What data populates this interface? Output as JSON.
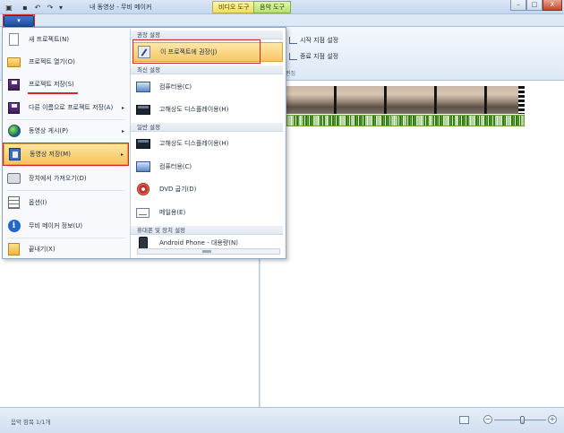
{
  "window": {
    "title": "내 동영상 - 무비 메이커",
    "contextual_tabs": [
      "비디오 도구",
      "음악 도구"
    ],
    "controls": {
      "minimize": "–",
      "maximize": "□",
      "close": "X"
    }
  },
  "quick_access": {
    "menu_glyph": "▾"
  },
  "file_tab": {
    "label": "▾"
  },
  "ribbon": {
    "set_start_label": "시작 지점 설정",
    "set_end_label": "종료 지점 설정",
    "group_edit_label": "편집"
  },
  "file_menu": {
    "items": [
      {
        "label": "새 프로젝트(N)",
        "icon": "new-document-icon"
      },
      {
        "label": "프로젝트 열기(O)",
        "icon": "open-folder-icon"
      },
      {
        "label": "프로젝트 저장(S)",
        "icon": "save-disk-icon"
      },
      {
        "label": "다른 이름으로 프로젝트 저장(A)",
        "icon": "save-as-icon",
        "has_arrow": true
      },
      {
        "label": "동영상 게시(P)",
        "icon": "publish-globe-icon",
        "has_arrow": true
      },
      {
        "label": "동영상 저장(M)",
        "icon": "save-movie-icon",
        "has_arrow": true,
        "active": true
      },
      {
        "label": "장치에서 가져오기(D)",
        "icon": "import-device-icon"
      },
      {
        "label": "옵션(I)",
        "icon": "options-icon"
      },
      {
        "label": "무비 메이커 정보(U)",
        "icon": "info-icon"
      },
      {
        "label": "끝내기(X)",
        "icon": "exit-icon"
      }
    ]
  },
  "save_movie_submenu": {
    "section_recommended": "권장 설정",
    "recommended_item": "이 프로젝트에 권장(J)",
    "section_recent": "최신 설정",
    "recent_items": [
      "컴퓨터용(C)",
      "고해상도 디스플레이용(H)"
    ],
    "section_common": "일반 설정",
    "common_items": [
      "고해상도 디스플레이용(H)",
      "컴퓨터용(C)",
      "DVD 굽기(D)",
      "메일용(E)"
    ],
    "section_mobile": "휴대폰 및 장치 설정",
    "mobile_item": "Android Phone - 대용량(N)"
  },
  "status": {
    "text": "음악 항목 1/1개",
    "zoom_minus": "−",
    "zoom_plus": "+",
    "zoom_level_fraction": 0.55
  }
}
